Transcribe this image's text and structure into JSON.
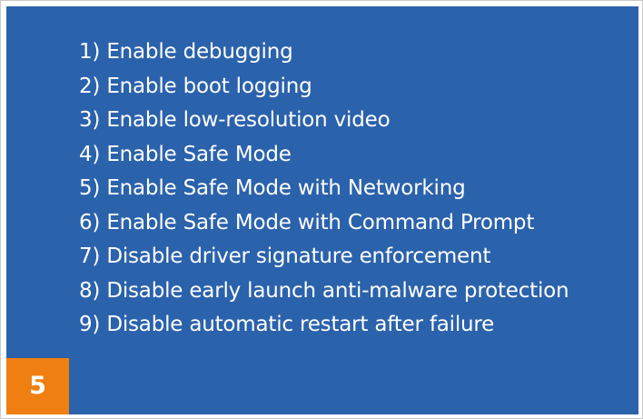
{
  "menu": {
    "options": [
      "1) Enable debugging",
      "2) Enable boot logging",
      "3) Enable low-resolution video",
      "4) Enable Safe Mode",
      "5) Enable Safe Mode with Networking",
      "6) Enable Safe Mode with Command Prompt",
      "7) Disable driver signature enforcement",
      "8) Disable early launch anti-malware protection",
      "9) Disable automatic restart after failure"
    ]
  },
  "badge": {
    "label": "5"
  },
  "colors": {
    "screen_background": "#2b62ac",
    "option_text": "#ffffff",
    "badge_background": "#f07f12",
    "badge_text": "#ffffff"
  }
}
